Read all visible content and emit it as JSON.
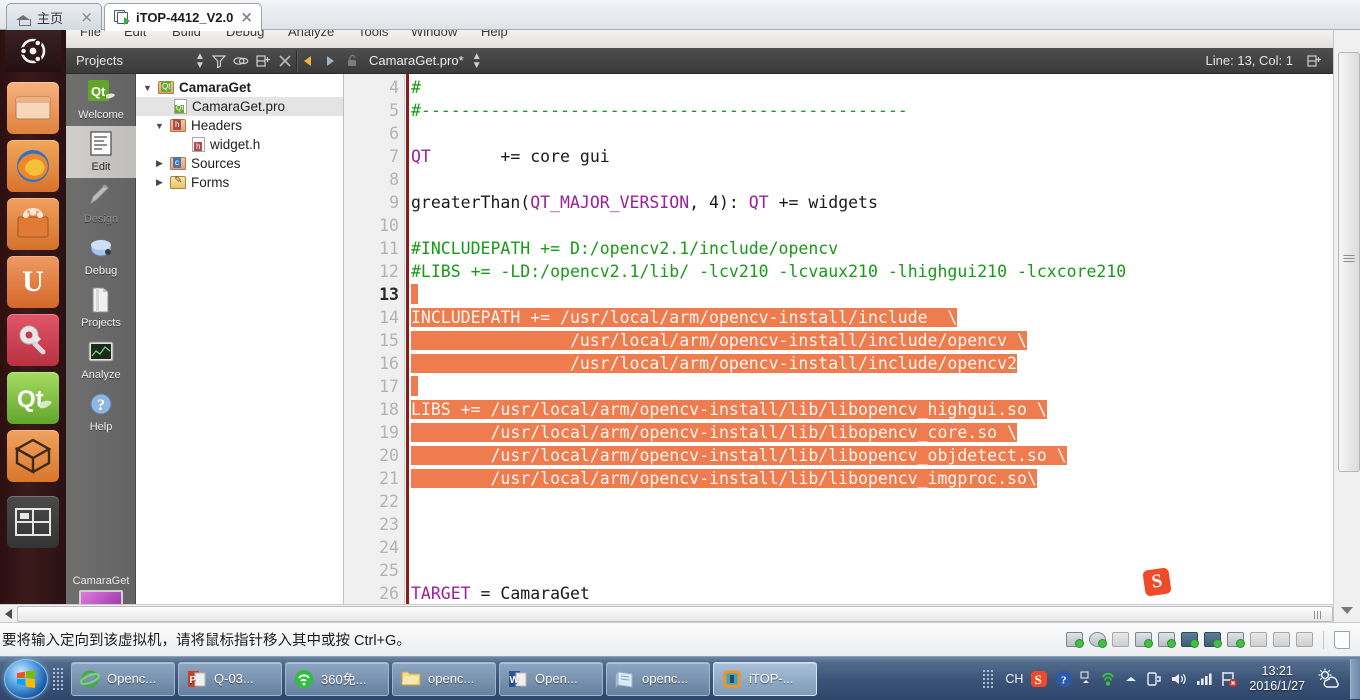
{
  "vmware": {
    "tabs": [
      {
        "label": "主页",
        "icon": "home-icon",
        "active": false
      },
      {
        "label": "iTOP-4412_V2.0",
        "icon": "vm-file-icon",
        "active": true
      }
    ],
    "status_message": "要将输入定向到该虚拟机，请将鼠标指针移入其中或按 Ctrl+G。",
    "device_icons": [
      "hard-disk-icon",
      "cd-dvd-icon",
      "floppy-icon",
      "network-adapter-icon",
      "printer-icon",
      "usb-controller-icon",
      "usb-device-icon",
      "sound-card-icon",
      "usb-disabled-icon",
      "usb-disabled-2-icon",
      "camera-icon"
    ]
  },
  "unity_launcher": {
    "items": [
      {
        "name": "ubuntu-logo-button",
        "label": "Ubuntu"
      },
      {
        "name": "files-icon",
        "label": "Files"
      },
      {
        "name": "firefox-icon",
        "label": "Firefox"
      },
      {
        "name": "software-center-icon",
        "label": "Ubuntu Software Center"
      },
      {
        "name": "ubuntu-one-icon",
        "label": "Ubuntu One"
      },
      {
        "name": "system-settings-icon",
        "label": "System Settings"
      },
      {
        "name": "qtcreator-icon",
        "label": "Qt Creator"
      },
      {
        "name": "archive-manager-icon",
        "label": "Archive Manager"
      },
      {
        "name": "workspace-switcher-icon",
        "label": "Workspace Switcher"
      }
    ]
  },
  "qtcreator": {
    "menus": [
      "File",
      "Edit",
      "Build",
      "Debug",
      "Analyze",
      "Tools",
      "Window",
      "Help"
    ],
    "toolbar": {
      "project_selector": "Projects",
      "filter_icon": "filter-icon",
      "link_icon": "link-editors-icon",
      "split_icon": "split-editor-icon",
      "close_icon": "close-document-icon",
      "back_icon": "navigate-back-icon",
      "forward_icon": "navigate-forward-icon",
      "lock_icon": "unlocked-icon",
      "file_name": "CamaraGet.pro*",
      "line_col": "Line: 13, Col: 1",
      "split_right_icon": "split-editor-icon"
    },
    "modes": [
      {
        "label": "Welcome",
        "icon": "qt-welcome-icon",
        "state": "normal"
      },
      {
        "label": "Edit",
        "icon": "edit-mode-icon",
        "state": "selected"
      },
      {
        "label": "Design",
        "icon": "design-mode-icon",
        "state": "disabled"
      },
      {
        "label": "Debug",
        "icon": "debug-mode-icon",
        "state": "normal"
      },
      {
        "label": "Projects",
        "icon": "projects-mode-icon",
        "state": "normal"
      },
      {
        "label": "Analyze",
        "icon": "analyze-mode-icon",
        "state": "normal"
      },
      {
        "label": "Help",
        "icon": "help-mode-icon",
        "state": "normal"
      }
    ],
    "kit_selector": {
      "label": "CamaraGet"
    },
    "project_tree": [
      {
        "depth": 0,
        "twisty": "▼",
        "icon": "qt-project-folder-icon",
        "label": "CamaraGet",
        "bold": true,
        "selected": false
      },
      {
        "depth": 1,
        "twisty": "",
        "icon": "qt-pro-file-icon",
        "label": "CamaraGet.pro",
        "bold": false,
        "selected": true
      },
      {
        "depth": 1,
        "twisty": "▼",
        "icon": "headers-folder-icon",
        "label": "Headers",
        "bold": false,
        "selected": false
      },
      {
        "depth": 2,
        "twisty": "",
        "icon": "header-file-icon",
        "label": "widget.h",
        "bold": false,
        "selected": false
      },
      {
        "depth": 1,
        "twisty": "▶",
        "icon": "sources-folder-icon",
        "label": "Sources",
        "bold": false,
        "selected": false
      },
      {
        "depth": 1,
        "twisty": "▶",
        "icon": "forms-folder-icon",
        "label": "Forms",
        "bold": false,
        "selected": false
      }
    ],
    "editor": {
      "first_visible_line": 4,
      "cursor_line": 13,
      "selection_color": "#ee7c4e",
      "comment_color": "#179a17",
      "keyword_color": "#9b1f9b",
      "lines": [
        {
          "n": 4,
          "segments": [
            {
              "t": "#",
              "c": "cmt"
            }
          ]
        },
        {
          "n": 5,
          "segments": [
            {
              "t": "#-------------------------------------------------",
              "c": "cmt"
            }
          ]
        },
        {
          "n": 6,
          "segments": []
        },
        {
          "n": 7,
          "segments": [
            {
              "t": "QT",
              "c": "kw"
            },
            {
              "t": "       += core gui",
              "c": ""
            }
          ]
        },
        {
          "n": 8,
          "segments": []
        },
        {
          "n": 9,
          "segments": [
            {
              "t": "greaterThan(",
              "c": ""
            },
            {
              "t": "QT_MAJOR_VERSION",
              "c": "kw"
            },
            {
              "t": ", 4): ",
              "c": ""
            },
            {
              "t": "QT",
              "c": "kw"
            },
            {
              "t": " += widgets",
              "c": ""
            }
          ]
        },
        {
          "n": 10,
          "segments": []
        },
        {
          "n": 11,
          "segments": [
            {
              "t": "#INCLUDEPATH += D:/opencv2.1/include/opencv",
              "c": "cmt"
            }
          ]
        },
        {
          "n": 12,
          "segments": [
            {
              "t": "#LIBS += -LD:/opencv2.1/lib/ -lcv210 -lcvaux210 -lhighgui210 -lcxcore210",
              "c": "cmt"
            }
          ]
        },
        {
          "n": 13,
          "segments": [],
          "sel_empty": true,
          "current": true
        },
        {
          "n": 14,
          "segments": [
            {
              "t": "INCLUDEPATH += /usr/local/arm/opencv-install/include  \\",
              "c": "sel"
            }
          ]
        },
        {
          "n": 15,
          "segments": [
            {
              "t": "                /usr/local/arm/opencv-install/include/opencv \\",
              "c": "sel"
            }
          ]
        },
        {
          "n": 16,
          "segments": [
            {
              "t": "                /usr/local/arm/opencv-install/include/opencv2",
              "c": "sel"
            }
          ]
        },
        {
          "n": 17,
          "segments": [],
          "sel_empty": true
        },
        {
          "n": 18,
          "segments": [
            {
              "t": "LIBS += /usr/local/arm/opencv-install/lib/libopencv_highgui.so \\",
              "c": "sel"
            }
          ]
        },
        {
          "n": 19,
          "segments": [
            {
              "t": "        /usr/local/arm/opencv-install/lib/libopencv_core.so \\",
              "c": "sel"
            }
          ]
        },
        {
          "n": 20,
          "segments": [
            {
              "t": "        /usr/local/arm/opencv-install/lib/libopencv_objdetect.so \\",
              "c": "sel"
            }
          ]
        },
        {
          "n": 21,
          "segments": [
            {
              "t": "        /usr/local/arm/opencv-install/lib/libopencv_imgproc.so\\",
              "c": "sel"
            }
          ]
        },
        {
          "n": 22,
          "segments": []
        },
        {
          "n": 23,
          "segments": []
        },
        {
          "n": 24,
          "segments": []
        },
        {
          "n": 25,
          "segments": []
        },
        {
          "n": 26,
          "segments": [
            {
              "t": "TARGET",
              "c": "kw"
            },
            {
              "t": " = CamaraGet",
              "c": ""
            }
          ]
        }
      ],
      "watermark": "S"
    }
  },
  "taskbar": {
    "start_label": "Start",
    "buttons": [
      {
        "label": "Openc...",
        "icon": "internet-explorer-icon",
        "active": false
      },
      {
        "label": "Q-03...",
        "icon": "powerpoint-icon",
        "active": false
      },
      {
        "label": "360免...",
        "icon": "360-browser-icon",
        "active": false
      },
      {
        "label": "openc...",
        "icon": "folder-icon",
        "active": false
      },
      {
        "label": "Open...",
        "icon": "word-icon",
        "active": false
      },
      {
        "label": "openc...",
        "icon": "notepad-icon",
        "active": false
      },
      {
        "label": "iTOP-...",
        "icon": "vmware-icon",
        "active": true
      }
    ],
    "tray": {
      "ime_label": "CH",
      "icons": [
        "sogou-pinyin-icon",
        "help-icon",
        "show-hidden-icons-icon",
        "360-shield-icon",
        "up-arrow-icon",
        "battery-icon",
        "volume-icon",
        "signal-icon",
        "action-center-flag-icon"
      ],
      "time": "13:21",
      "date": "2016/1/27",
      "weather_icon": "weather-sun-cloud-icon"
    }
  }
}
